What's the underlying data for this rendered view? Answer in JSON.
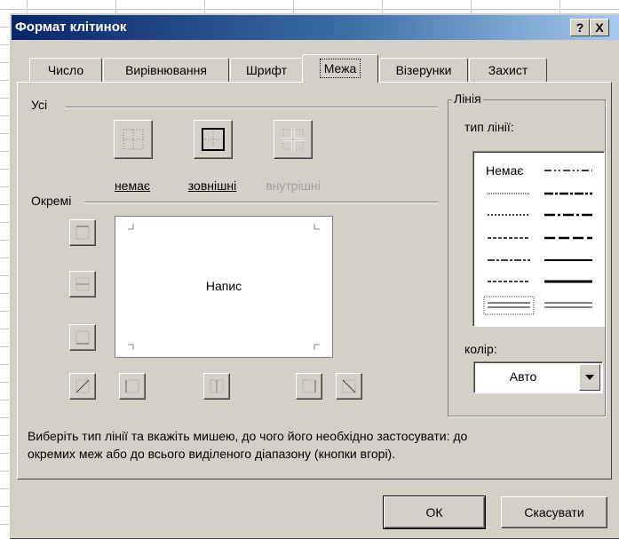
{
  "dialog": {
    "title": "Формат клітинок",
    "help_label": "?",
    "close_label": "X"
  },
  "tabs": [
    {
      "label": "Число"
    },
    {
      "label": "Вирівнювання"
    },
    {
      "label": "Шрифт"
    },
    {
      "label": "Межа",
      "active": true
    },
    {
      "label": "Візерунки"
    },
    {
      "label": "Захист"
    }
  ],
  "presets": {
    "group_label": "Усі",
    "none_label": "немає",
    "outline_label": "зовнішні",
    "inside_label": "внутрішні"
  },
  "border": {
    "group_label": "Окремі",
    "preview_text": "Напис"
  },
  "line": {
    "group_label": "Лінія",
    "style_label": "тип лінії:",
    "none_style_label": "Немає",
    "color_label": "колір:",
    "color_value": "Авто"
  },
  "info_text_1": "Виберіть тип лінії та вкажіть мишею, до чого його необхідно застосувати: до",
  "info_text_2": "окремих меж або до всього виділеного діапазону (кнопки вгорі).",
  "buttons": {
    "ok": "ОК",
    "cancel": "Скасувати"
  },
  "colors": {
    "titlebar_start": "#0a246a",
    "titlebar_end": "#a6caf0",
    "dialog_bg": "#d4d0c8"
  }
}
